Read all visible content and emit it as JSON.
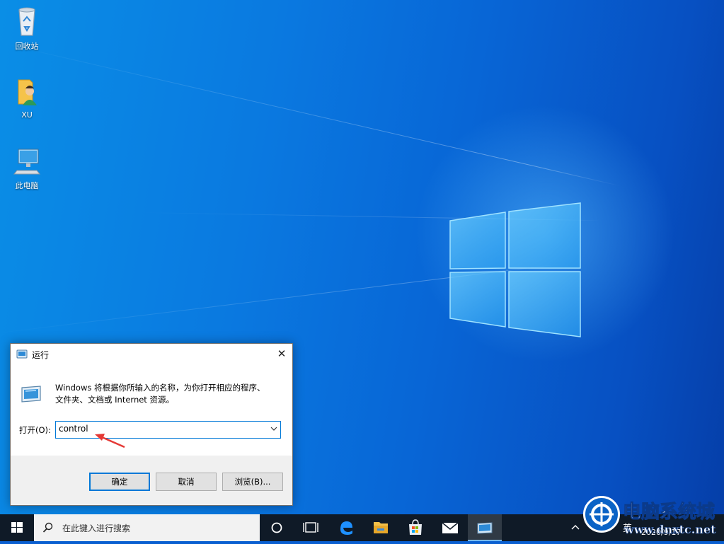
{
  "desktop": {
    "icons": [
      {
        "label": "回收站",
        "icon": "recycle-bin-icon"
      },
      {
        "label": "XU",
        "icon": "user-folder-icon"
      },
      {
        "label": "此电脑",
        "icon": "this-pc-icon"
      }
    ]
  },
  "run_dialog": {
    "title": "运行",
    "description_line1": "Windows 将根据你所输入的名称，为你打开相应的程序、",
    "description_line2": "文件夹、文档或 Internet 资源。",
    "open_label": "打开(O):",
    "input_value": "control",
    "ok_label": "确定",
    "cancel_label": "取消",
    "browse_label": "浏览(B)...",
    "close_icon": "close-icon"
  },
  "taskbar": {
    "search_placeholder": "在此键入进行搜索",
    "apps": [
      "cortana-icon",
      "task-view-icon",
      "edge-icon",
      "file-explorer-icon",
      "store-icon",
      "mail-icon",
      "run-icon"
    ],
    "tray_ime": "英",
    "tray_date": "2020/9/17"
  },
  "watermark": {
    "title": "电脑系统城",
    "url": "www.dnxtc.net"
  },
  "colors": {
    "accent": "#0078d7",
    "taskbar": "#0f1a27",
    "annotation_arrow": "#e53935"
  }
}
